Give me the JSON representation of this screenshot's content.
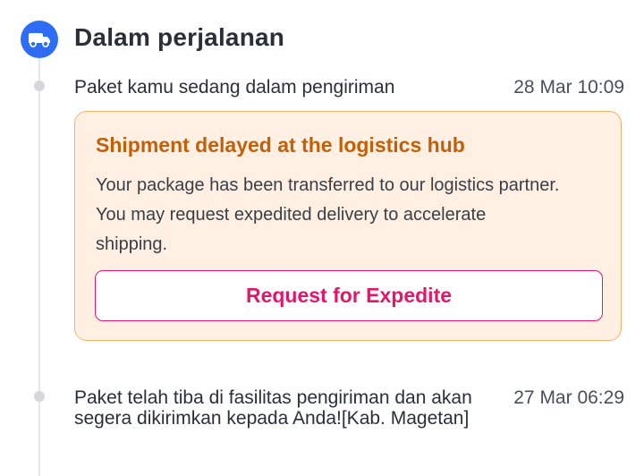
{
  "status": {
    "icon": "truck-icon",
    "title": "Dalam perjalanan",
    "icon_color": "#2f6cf6"
  },
  "events": [
    {
      "text": "Paket kamu sedang dalam pengiriman",
      "time": "28 Mar 10:09"
    },
    {
      "text": "Paket telah tiba di fasilitas pengiriman dan akan segera dikirimkan kepada Anda![Kab. Magetan]",
      "time": "27 Mar 06:29"
    }
  ],
  "alert": {
    "title": "Shipment delayed at the logistics hub",
    "body": "Your package has been transferred to our logistics partner. You may request expedited delivery to accelerate shipping.",
    "button_label": "Request for Expedite",
    "accent_color": "#c2600a",
    "button_color": "#e3166b",
    "background_color": "#fff0e3"
  }
}
